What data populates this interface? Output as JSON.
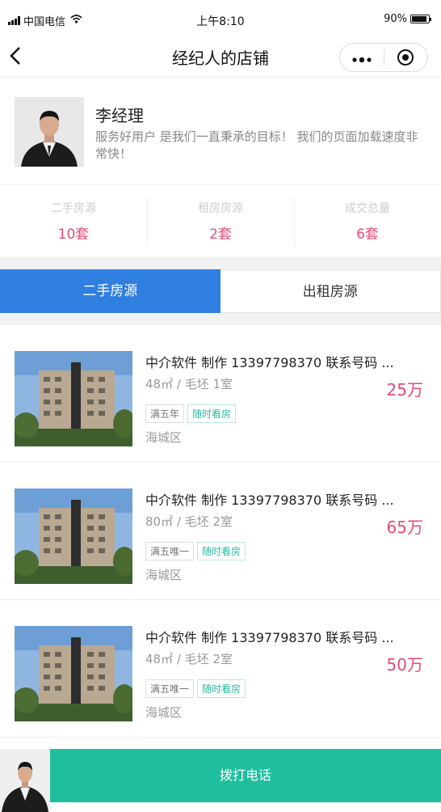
{
  "status_bar": {
    "carrier": "中国电信",
    "time": "上午8:10",
    "battery": "90%",
    "battery_level": 0.9
  },
  "nav": {
    "title": "经纪人的店铺",
    "back_icon": "chevron-left-icon",
    "more_icon": "more-dots-icon",
    "close_icon": "target-close-icon"
  },
  "agent": {
    "name": "李经理",
    "description": "服务好用户 是我们一直秉承的目标！ 我们的页面加载速度非常快！"
  },
  "stats": [
    {
      "label": "二手房源",
      "value": "10套"
    },
    {
      "label": "租房房源",
      "value": "2套"
    },
    {
      "label": "成交总量",
      "value": "6套"
    }
  ],
  "tabs": [
    {
      "label": "二手房源",
      "active": true
    },
    {
      "label": "出租房源",
      "active": false
    }
  ],
  "listings": [
    {
      "title": "中介软件 制作 13397798370 联系号码 ...",
      "spec": "48㎡ / 毛坯 1室",
      "price": "25万",
      "tags": [
        "满五年",
        "随时看房"
      ],
      "district": "海城区"
    },
    {
      "title": "中介软件 制作 13397798370 联系号码 ...",
      "spec": "80㎡ / 毛坯 2室",
      "price": "65万",
      "tags": [
        "满五唯一",
        "随时看房"
      ],
      "district": "海城区"
    },
    {
      "title": "中介软件 制作 13397798370 联系号码 ...",
      "spec": "48㎡ / 毛坯 2室",
      "price": "50万",
      "tags": [
        "满五唯一",
        "随时看房"
      ],
      "district": "海城区"
    }
  ],
  "bottom_bar": {
    "call_label": "拨打电话"
  },
  "colors": {
    "accent_pink": "#e64a75",
    "tab_blue": "#2f7fe0",
    "call_green": "#1fbf9e",
    "tag_teal": "#28bba2"
  }
}
